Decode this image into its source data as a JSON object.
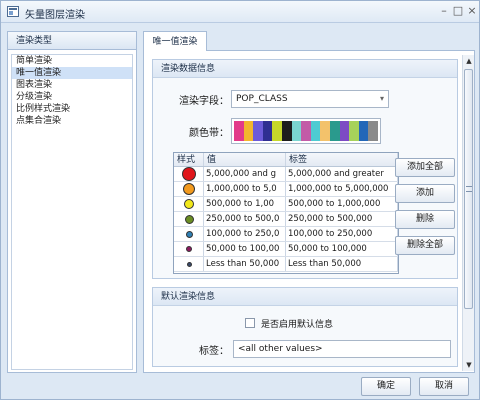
{
  "window": {
    "title": "矢量图层渲染",
    "minimize": "–",
    "maximize": "□",
    "close": "×"
  },
  "left_panel": {
    "header": "渲染类型",
    "items": [
      "简单渲染",
      "唯一值渲染",
      "图表渲染",
      "分级渲染",
      "比例样式渲染",
      "点集合渲染"
    ],
    "selected_index": 1
  },
  "tab": {
    "label": "唯一值渲染"
  },
  "data_section": {
    "header": "渲染数据信息",
    "field_label": "渲染字段：",
    "field_value": "POP_CLASS",
    "dropdown_arrow": "▾",
    "ramp_label": "颜色带：",
    "ramp_colors": [
      "#e23a8a",
      "#f2b62d",
      "#6c5bd9",
      "#2f2f92",
      "#c6d82a",
      "#1d1d1d",
      "#7ad5d0",
      "#c25ba7",
      "#4ecbd2",
      "#f3c26b",
      "#2a9a8d",
      "#7d4ac4",
      "#a7d25a",
      "#2367b8",
      "#8a8a8a"
    ],
    "table": {
      "headers": [
        "样式",
        "值",
        "标签"
      ],
      "rows": [
        {
          "value": "5,000,000 and g",
          "label": "5,000,000 and greater",
          "color": "#e0161b"
        },
        {
          "value": "1,000,000 to 5,0",
          "label": "1,000,000 to 5,000,000",
          "color": "#f29a1e"
        },
        {
          "value": "500,000 to 1,00",
          "label": "500,000 to 1,000,000",
          "color": "#f2e81a"
        },
        {
          "value": "250,000 to 500,0",
          "label": "250,000 to 500,000",
          "color": "#6b8e23"
        },
        {
          "value": "100,000 to 250,0",
          "label": "100,000 to 250,000",
          "color": "#2f7fb3"
        },
        {
          "value": "50,000 to 100,00",
          "label": "50,000 to 100,000",
          "color": "#8b1a5f"
        },
        {
          "value": "Less than 50,000",
          "label": "Less than 50,000",
          "color": "#3a4a6a"
        }
      ]
    },
    "buttons": {
      "add_all": "添加全部",
      "add": "添加",
      "delete": "删除",
      "delete_all": "删除全部"
    }
  },
  "default_section": {
    "header": "默认渲染信息",
    "checkbox_label": "是否启用默认信息",
    "label_field_label": "标签：",
    "label_value": "<all other values>"
  },
  "scrollbar": {
    "up": "▲",
    "down": "▼"
  },
  "footer": {
    "ok": "确定",
    "cancel": "取消"
  }
}
